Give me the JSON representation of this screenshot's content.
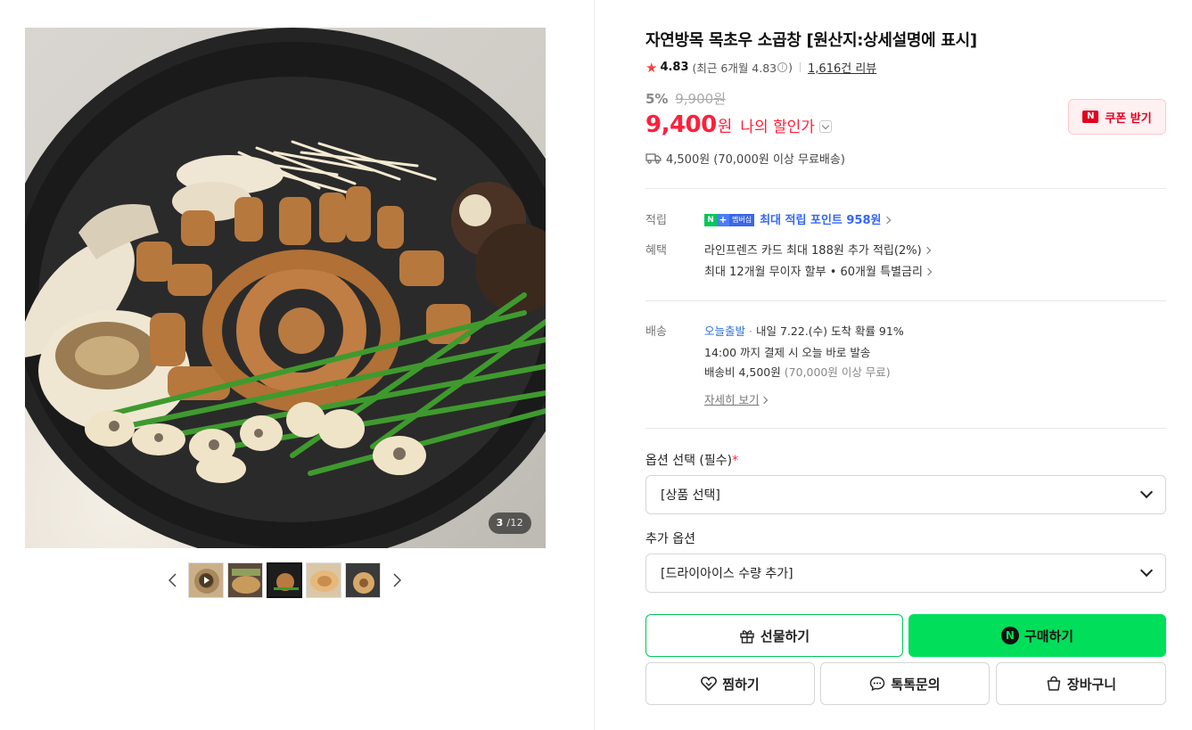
{
  "gallery": {
    "current_page": "3",
    "total_pages": "12",
    "thumbnails": [
      {
        "name": "thumb-1",
        "video": true
      },
      {
        "name": "thumb-2",
        "video": false
      },
      {
        "name": "thumb-3",
        "video": false,
        "active": true
      },
      {
        "name": "thumb-4",
        "video": false
      },
      {
        "name": "thumb-5",
        "video": false
      }
    ],
    "prev_icon": "chevron-left-icon",
    "next_icon": "chevron-right-icon"
  },
  "product": {
    "title": "자연방목 목초우 소곱창 [원산지:상세설명에 표시]",
    "rating": "4.83",
    "recent_rating_text": "(최근 6개월 4.83",
    "recent_rating_close": ")",
    "review_count": "1,616건 리뷰",
    "discount_rate": "5%",
    "original_price": "9,900원",
    "price": "9,400",
    "price_unit": "원",
    "my_price_label": "나의 할인가",
    "coupon_label": "쿠폰 받기",
    "coupon_icon": "N",
    "shipping_summary": "4,500원 (70,000원 이상 무료배송)"
  },
  "benefits": {
    "point_label": "적립",
    "npay_n": "N",
    "npay_plus": "+",
    "npay_member": "멤버십",
    "point_text": "최대 적립 포인트 958원",
    "benefit_label": "혜택",
    "benefit_line1": "라인프렌즈 카드 최대 188원 추가 적립(2%)",
    "benefit_line2": "최대 12개월 무이자 할부 • 60개월 특별금리"
  },
  "delivery": {
    "label": "배송",
    "today_label": "오늘출발",
    "dot": "·",
    "arrival": "내일 7.22.(수) 도착 확률 91%",
    "cutoff": "14:00 까지 결제 시 오늘 바로 발송",
    "fee": "배송비 4,500원",
    "fee_note": "(70,000원 이상 무료)",
    "detail_link": "자세히 보기"
  },
  "options": {
    "required_label": "옵션 선택 (필수)",
    "required_mark": "*",
    "required_value": "[상품 선택]",
    "extra_label": "추가 옵션",
    "extra_value": "[드라이아이스 수량 추가]"
  },
  "actions": {
    "gift": "선물하기",
    "buy": "구매하기",
    "buy_icon": "N",
    "wish": "찜하기",
    "talk": "톡톡문의",
    "cart": "장바구니"
  },
  "colors": {
    "price_red": "#ff1f3c",
    "naver_green": "#03c75a",
    "buy_green": "#00de5a",
    "point_blue": "#3366ff",
    "today_blue": "#2b6fd9"
  }
}
